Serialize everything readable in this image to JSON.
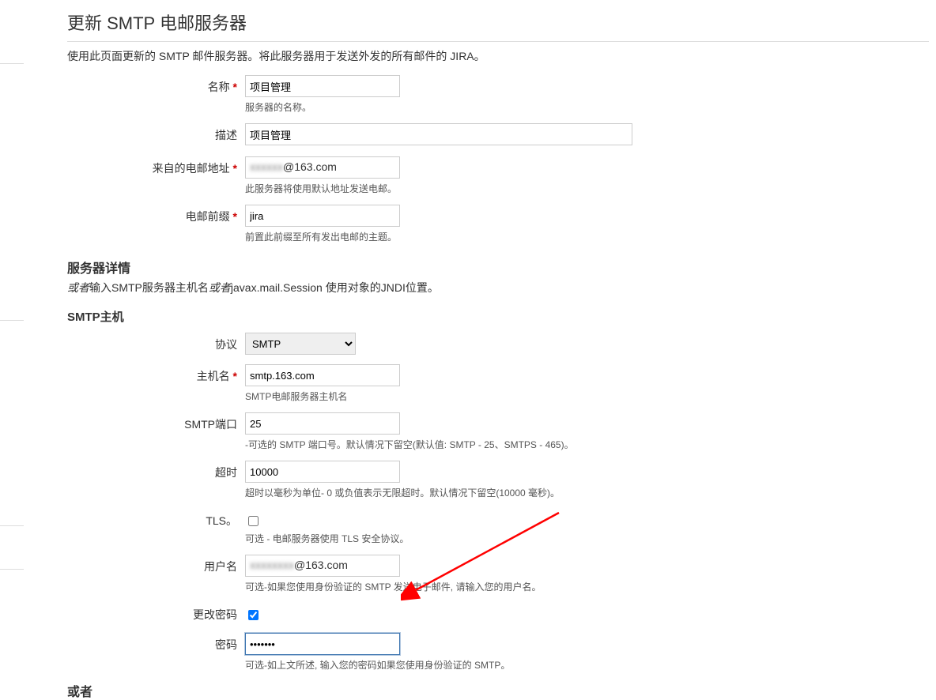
{
  "page_title": "更新 SMTP 电邮服务器",
  "page_desc": "使用此页面更新的 SMTP 邮件服务器。将此服务器用于发送外发的所有邮件的 JIRA。",
  "fields": {
    "name": {
      "label": "名称",
      "value": "项目管理",
      "help": "服务器的名称。"
    },
    "desc": {
      "label": "描述",
      "value": "项目管理"
    },
    "from": {
      "label": "来自的电邮地址",
      "value_prefix": "xxxxxx",
      "value_suffix": "@163.com",
      "help": "此服务器将使用默认地址发送电邮。"
    },
    "prefix": {
      "label": "电邮前缀",
      "value": "jira",
      "help": "前置此前缀至所有发出电邮的主题。"
    }
  },
  "section1": {
    "heading": "服务器详情",
    "or_prefix": "或者",
    "text_mid": "输入SMTP服务器主机名",
    "or_mid": "或者",
    "text_end": "javax.mail.Session 使用对象的JNDI位置。"
  },
  "section2": {
    "heading": "SMTP主机"
  },
  "smtp": {
    "protocol": {
      "label": "协议",
      "value": "SMTP"
    },
    "host": {
      "label": "主机名",
      "value": "smtp.163.com",
      "help": "SMTP电邮服务器主机名"
    },
    "port": {
      "label": "SMTP端口",
      "value": "25",
      "help": "-可选的 SMTP 端口号。默认情况下留空(默认值: SMTP - 25、SMTPS - 465)。"
    },
    "timeout": {
      "label": "超时",
      "value": "10000",
      "help": "超时以毫秒为单位- 0 或负值表示无限超时。默认情况下留空(10000 毫秒)。"
    },
    "tls": {
      "label": "TLS。",
      "help": "可选 - 电邮服务器使用 TLS 安全协议。"
    },
    "user": {
      "label": "用户名",
      "value_prefix": "xxxxxxxx",
      "value_suffix": "@163.com",
      "help": "可选-如果您使用身份验证的 SMTP 发送电子邮件, 请输入您的用户名。"
    },
    "changepw": {
      "label": "更改密码"
    },
    "password": {
      "label": "密码",
      "value": "•••••••",
      "help": "可选-如上文所述, 输入您的密码如果您使用身份验证的 SMTP。"
    }
  },
  "or_heading": "或者"
}
